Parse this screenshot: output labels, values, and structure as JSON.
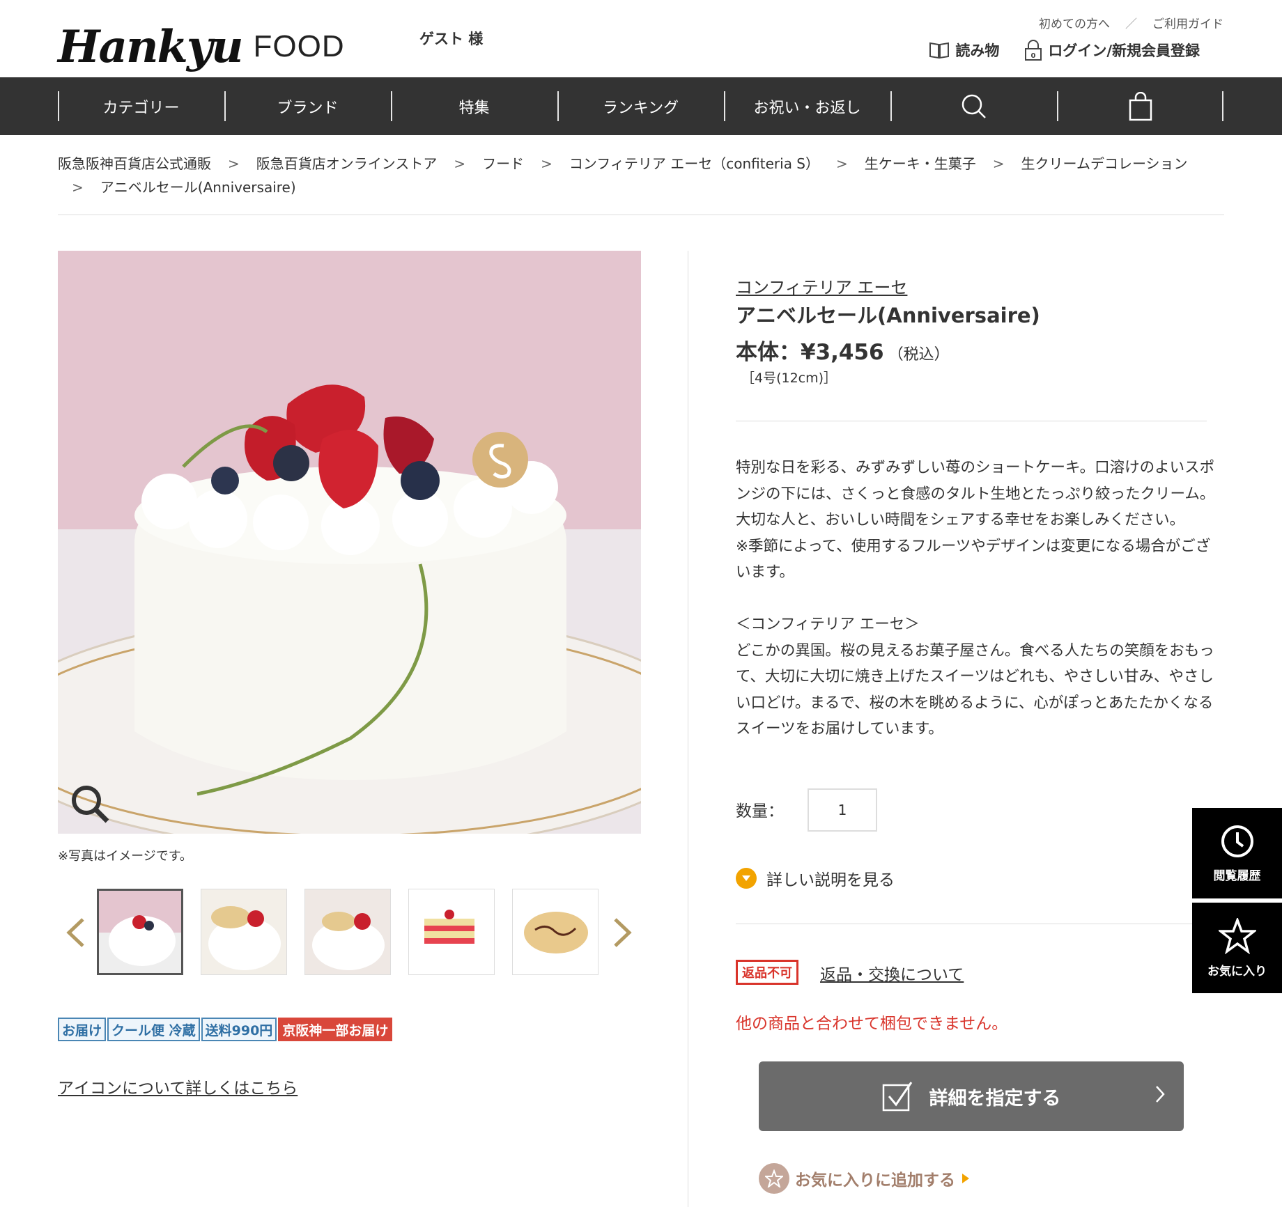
{
  "header": {
    "logo_script": "Hankyu",
    "logo_text": "FOOD",
    "guest": "ゲスト 様",
    "first_time": "初めての方へ",
    "separator": "／",
    "guide": "ご利用ガイド",
    "reading": "読み物",
    "login": "ログイン/新規会員登録"
  },
  "nav": {
    "items": [
      "カテゴリー",
      "ブランド",
      "特集",
      "ランキング",
      "お祝い・お返し"
    ],
    "search_icon": "search-icon",
    "cart_icon": "shopping-bag-icon"
  },
  "breadcrumb": {
    "items": [
      "阪急阪神百貨店公式通販",
      "阪急百貨店オンラインストア",
      "フード",
      "コンフィテリア エーセ（confiteria S）",
      "生ケーキ・生菓子",
      "生クリームデコレーション",
      "アニベルセール(Anniversaire)"
    ],
    "separator": ">"
  },
  "gallery": {
    "note": "※写真はイメージです。",
    "thumb_count": 5
  },
  "badges": [
    "お届け",
    "クール便 冷蔵",
    "送料990円",
    "京阪神一部お届け"
  ],
  "icon_link": "アイコンについて詳しくはこちら",
  "product": {
    "brand": "コンフィテリア エーセ",
    "title": "アニベルセール(Anniversaire)",
    "price": "本体：¥3,456",
    "tax": "（税込）",
    "size": "［4号(12cm)］",
    "description": "特別な日を彩る、みずみずしい苺のショートケーキ。口溶けのよいスポンジの下には、さくっと食感のタルト生地とたっぷり絞ったクリーム。大切な人と、おいしい時間をシェアする幸せをお楽しみください。\n※季節によって、使用するフルーツやデザインは変更になる場合がございます。\n\n＜コンフィテリア エーセ＞\nどこかの異国。桜の見えるお菓子屋さん。食べる人たちの笑顔をおもって、大切に大切に焼き上げたスイーツはどれも、やさしい甘み、やさしい口どけ。まるで、桜の木を眺めるように、心がぽっとあたたかくなるスイーツをお届けしています。",
    "qty_label": "数量：",
    "qty_value": "1",
    "more_label": "詳しい説明を見る",
    "no_return": "返品不可",
    "return_link": "返品・交換について",
    "no_pack": "他の商品と合わせて梱包できません。",
    "detail_button": "詳細を指定する",
    "favorite_add": "お気に入りに追加する"
  },
  "side": {
    "history": "閲覧履歴",
    "favorite": "お気に入り"
  },
  "colors": {
    "nav_bg": "#333333",
    "accent_red": "#d9342b",
    "badge_blue": "#2f6fa4",
    "more_orange": "#f2a300",
    "button_gray": "#6b6b6b",
    "fav_brown": "#a27e6b"
  }
}
